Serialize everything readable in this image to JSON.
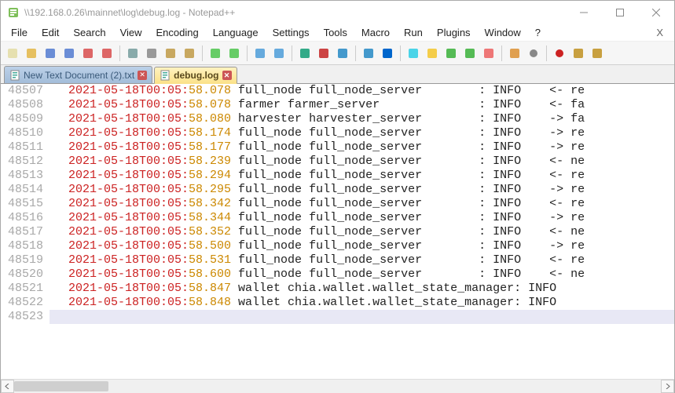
{
  "window": {
    "title": "\\\\192.168.0.26\\mainnet\\log\\debug.log - Notepad++"
  },
  "menu": {
    "items": [
      "File",
      "Edit",
      "Search",
      "View",
      "Encoding",
      "Language",
      "Settings",
      "Tools",
      "Macro",
      "Run",
      "Plugins",
      "Window",
      "?"
    ]
  },
  "toolbar": {
    "icons": [
      "new",
      "open",
      "save",
      "save-all",
      "close",
      "close-all",
      "print",
      "cut",
      "copy",
      "paste",
      "undo",
      "redo",
      "find",
      "replace",
      "zoom-in",
      "zoom-out",
      "sync",
      "wrap",
      "all-chars",
      "indent",
      "lang",
      "fold",
      "fold-all",
      "unfold",
      "folder",
      "eye",
      "record",
      "play",
      "pause"
    ]
  },
  "tabs": [
    {
      "label": "New Text Document (2).txt",
      "active": false
    },
    {
      "label": "debug.log",
      "active": true
    }
  ],
  "log": {
    "rows": [
      {
        "ln": "48507",
        "d": "2021-05-18",
        "t": "T00:05:",
        "s": "58.078",
        "body": " full_node full_node_server        ",
        "level": ": INFO",
        "tail": "    <- re"
      },
      {
        "ln": "48508",
        "d": "2021-05-18",
        "t": "T00:05:",
        "s": "58.078",
        "body": " farmer farmer_server              ",
        "level": ": INFO",
        "tail": "    <- fa"
      },
      {
        "ln": "48509",
        "d": "2021-05-18",
        "t": "T00:05:",
        "s": "58.080",
        "body": " harvester harvester_server        ",
        "level": ": INFO",
        "tail": "    -> fa"
      },
      {
        "ln": "48510",
        "d": "2021-05-18",
        "t": "T00:05:",
        "s": "58.174",
        "body": " full_node full_node_server        ",
        "level": ": INFO",
        "tail": "    -> re"
      },
      {
        "ln": "48511",
        "d": "2021-05-18",
        "t": "T00:05:",
        "s": "58.177",
        "body": " full_node full_node_server        ",
        "level": ": INFO",
        "tail": "    -> re"
      },
      {
        "ln": "48512",
        "d": "2021-05-18",
        "t": "T00:05:",
        "s": "58.239",
        "body": " full_node full_node_server        ",
        "level": ": INFO",
        "tail": "    <- ne"
      },
      {
        "ln": "48513",
        "d": "2021-05-18",
        "t": "T00:05:",
        "s": "58.294",
        "body": " full_node full_node_server        ",
        "level": ": INFO",
        "tail": "    <- re"
      },
      {
        "ln": "48514",
        "d": "2021-05-18",
        "t": "T00:05:",
        "s": "58.295",
        "body": " full_node full_node_server        ",
        "level": ": INFO",
        "tail": "    -> re"
      },
      {
        "ln": "48515",
        "d": "2021-05-18",
        "t": "T00:05:",
        "s": "58.342",
        "body": " full_node full_node_server        ",
        "level": ": INFO",
        "tail": "    <- re"
      },
      {
        "ln": "48516",
        "d": "2021-05-18",
        "t": "T00:05:",
        "s": "58.344",
        "body": " full_node full_node_server        ",
        "level": ": INFO",
        "tail": "    -> re"
      },
      {
        "ln": "48517",
        "d": "2021-05-18",
        "t": "T00:05:",
        "s": "58.352",
        "body": " full_node full_node_server        ",
        "level": ": INFO",
        "tail": "    <- ne"
      },
      {
        "ln": "48518",
        "d": "2021-05-18",
        "t": "T00:05:",
        "s": "58.500",
        "body": " full_node full_node_server        ",
        "level": ": INFO",
        "tail": "    -> re"
      },
      {
        "ln": "48519",
        "d": "2021-05-18",
        "t": "T00:05:",
        "s": "58.531",
        "body": " full_node full_node_server        ",
        "level": ": INFO",
        "tail": "    <- re"
      },
      {
        "ln": "48520",
        "d": "2021-05-18",
        "t": "T00:05:",
        "s": "58.600",
        "body": " full_node full_node_server        ",
        "level": ": INFO",
        "tail": "    <- ne"
      },
      {
        "ln": "48521",
        "d": "2021-05-18",
        "t": "T00:05:",
        "s": "58.847",
        "body": " wallet chia.wallet.wallet_state_manager",
        "level": ": INFO",
        "tail": "    "
      },
      {
        "ln": "48522",
        "d": "2021-05-18",
        "t": "T00:05:",
        "s": "58.848",
        "body": " wallet chia.wallet.wallet_state_manager",
        "level": ": INFO",
        "tail": "    "
      },
      {
        "ln": "48523",
        "d": "",
        "t": "",
        "s": "",
        "body": "",
        "level": "",
        "tail": "",
        "current": true
      }
    ]
  }
}
